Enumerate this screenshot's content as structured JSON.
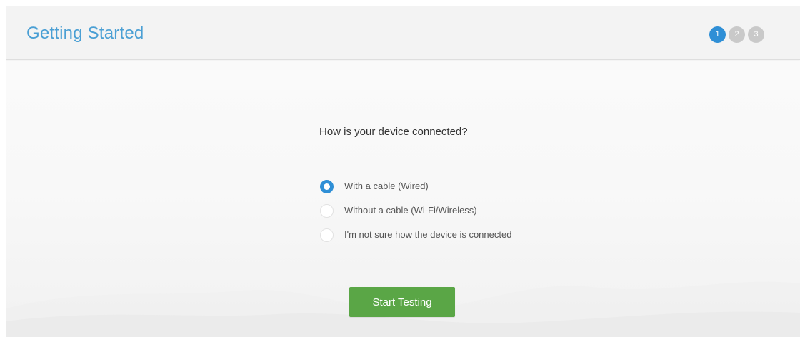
{
  "header": {
    "title": "Getting Started",
    "steps": [
      {
        "label": "1",
        "active": true
      },
      {
        "label": "2",
        "active": false
      },
      {
        "label": "3",
        "active": false
      }
    ]
  },
  "main": {
    "question": "How is your device connected?",
    "options": [
      {
        "label": "With a cable (Wired)",
        "selected": true
      },
      {
        "label": "Without a cable (Wi-Fi/Wireless)",
        "selected": false
      },
      {
        "label": "I'm not sure how the device is connected",
        "selected": false
      }
    ],
    "start_button_label": "Start Testing"
  },
  "colors": {
    "accent": "#2f8fd6",
    "title": "#4a9fd4",
    "button": "#5aa646"
  }
}
